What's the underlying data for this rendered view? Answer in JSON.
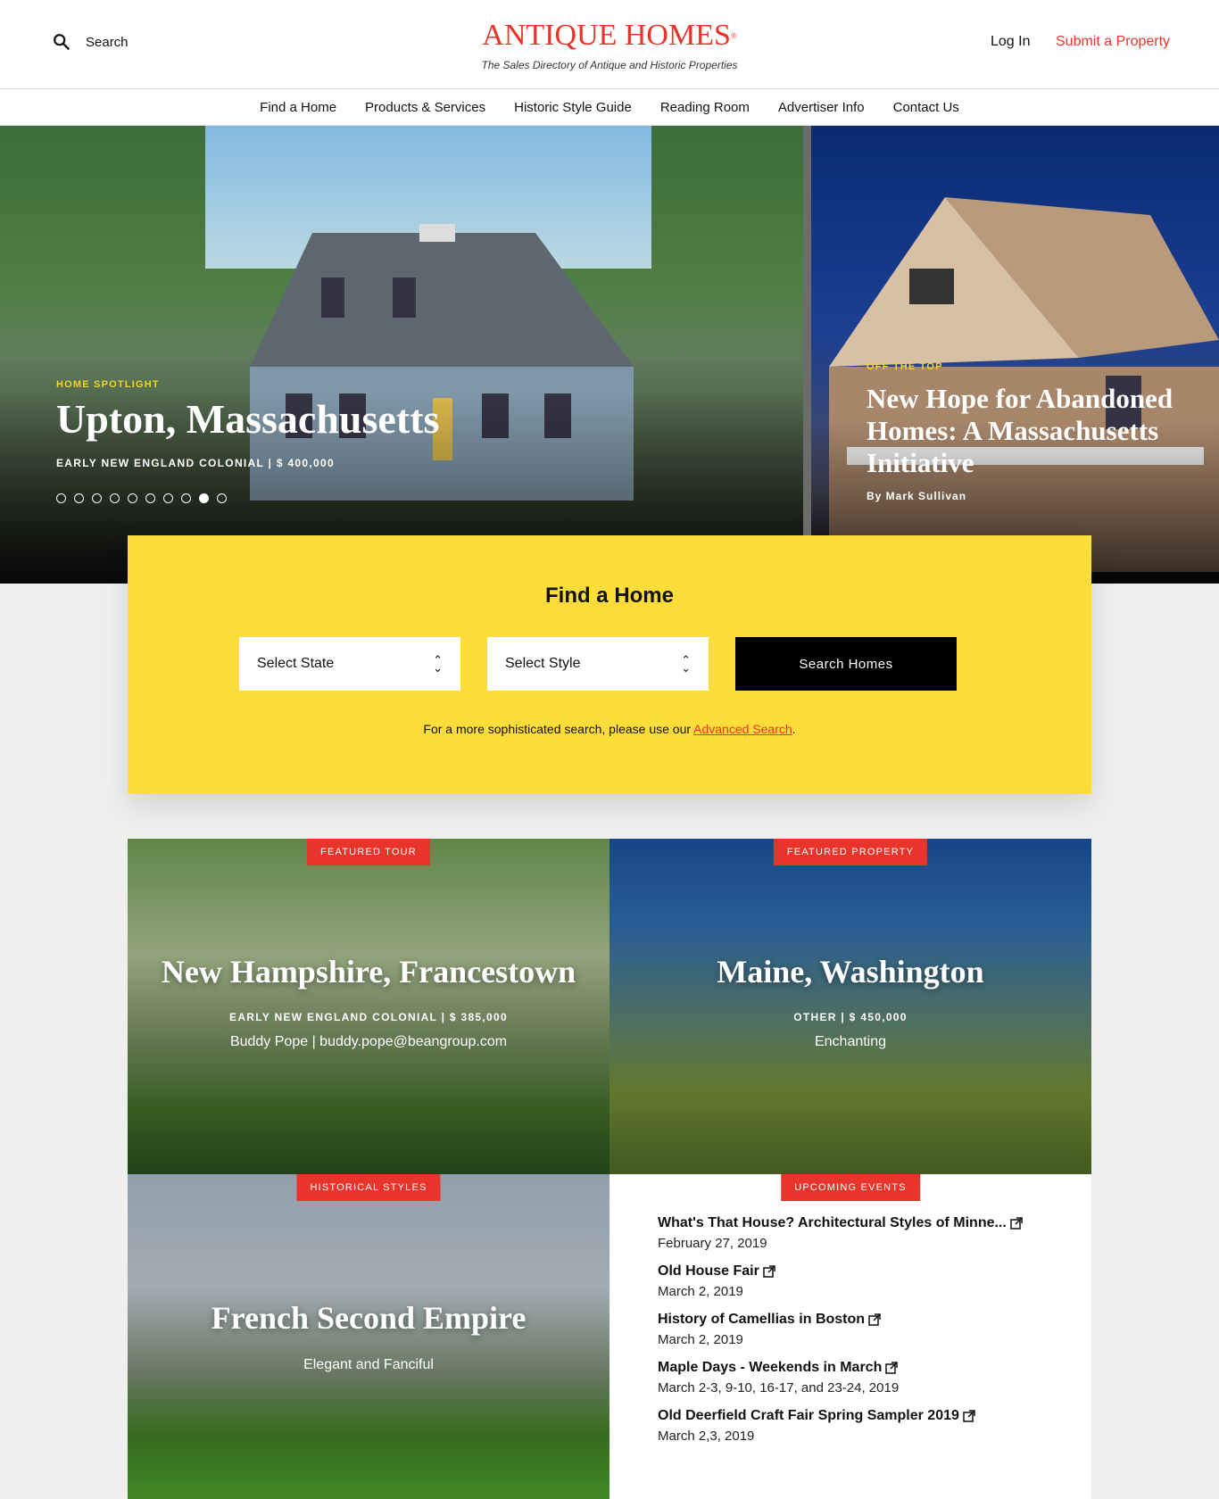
{
  "header": {
    "search_label": "Search",
    "logo": "ANTIQUE HOMES",
    "logo_mark": "®",
    "tagline": "The Sales Directory of Antique and Historic Properties",
    "login": "Log In",
    "submit": "Submit a Property"
  },
  "nav": [
    "Find a Home",
    "Products & Services",
    "Historic Style Guide",
    "Reading Room",
    "Advertiser Info",
    "Contact Us"
  ],
  "hero": {
    "kicker": "HOME SPOTLIGHT",
    "title": "Upton, Massachusetts",
    "meta": "EARLY NEW ENGLAND COLONIAL  |  $ 400,000",
    "dots_total": 10,
    "dots_active": 9
  },
  "side": {
    "kicker": "OFF THE TOP",
    "title": "New Hope for Abandoned Homes: A Massachusetts Initiative",
    "byline": "By Mark Sullivan"
  },
  "find": {
    "title": "Find a Home",
    "state": "Select State",
    "style": "Select Style",
    "button": "Search Homes",
    "note_pre": "For a more sophisticated search, please use our ",
    "note_link": "Advanced Search",
    "note_post": "."
  },
  "cards": {
    "tour": {
      "badge": "FEATURED TOUR",
      "title": "New Hampshire, Francestown",
      "meta": "EARLY NEW ENGLAND COLONIAL  |  $ 385,000",
      "sub": "Buddy Pope | buddy.pope@beangroup.com"
    },
    "property": {
      "badge": "FEATURED PROPERTY",
      "title": "Maine, Washington",
      "meta": "OTHER  |  $ 450,000",
      "sub": "Enchanting"
    },
    "styles": {
      "badge": "HISTORICAL STYLES",
      "title": "French Second Empire",
      "sub": "Elegant and Fanciful"
    },
    "events": {
      "badge": "UPCOMING EVENTS",
      "items": [
        {
          "title": "What's That House? Architectural Styles of Minne...",
          "date": "February 27, 2019"
        },
        {
          "title": "Old House Fair",
          "date": "March 2, 2019"
        },
        {
          "title": "History of Camellias in Boston",
          "date": "March 2, 2019"
        },
        {
          "title": "Maple Days - Weekends in March",
          "date": "March 2-3, 9-10, 16-17, and 23-24, 2019"
        },
        {
          "title": "Old Deerfield Craft Fair Spring Sampler 2019",
          "date": "March 2,3, 2019"
        }
      ]
    }
  },
  "colors": {
    "accent": "#e8342a",
    "find_bg": "#fedd3a"
  }
}
